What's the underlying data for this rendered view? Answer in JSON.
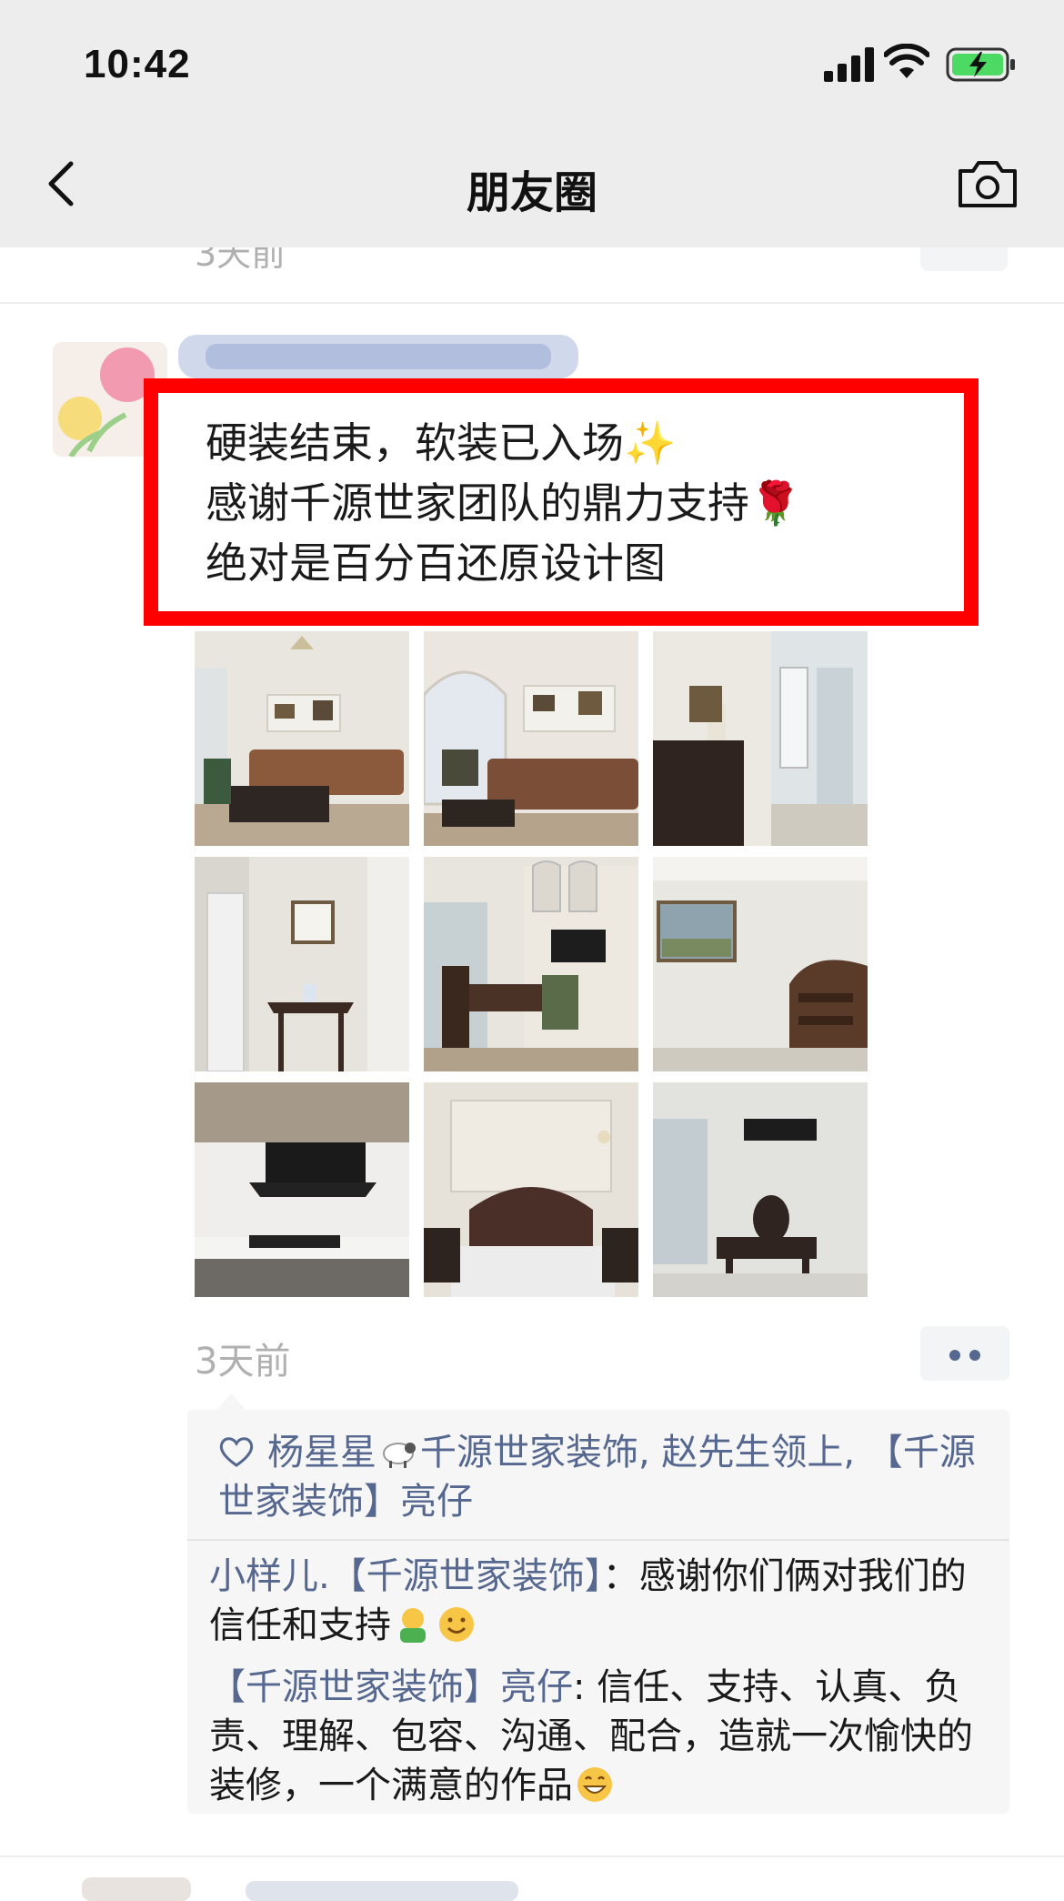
{
  "status_bar": {
    "time": "10:42"
  },
  "nav": {
    "title": "朋友圈"
  },
  "prev_post": {
    "time": "3天前"
  },
  "post": {
    "text_lines": [
      "硬装结束，软装已入场✨",
      "感谢千源世家团队的鼎力支持🌹",
      "绝对是百分百还原设计图"
    ],
    "time": "3天前",
    "photos": [
      "living-room-sofa",
      "living-room-window",
      "sideboard-balcony",
      "hallway-console",
      "dining-room",
      "bedroom-chair",
      "kitchen-range-hood",
      "bedroom-bed",
      "bedroom-vanity"
    ],
    "likes": {
      "text_before_emoji": "杨星星",
      "text_after_emoji": "千源世家装饰, 赵先生领上, 【千源世家装饰】亮仔"
    },
    "comments": [
      {
        "name": "小样儿.【千源世家装饰】",
        "text": "：感谢你们俩对我们的信任和支持"
      },
      {
        "name": "【千源世家装饰】亮仔",
        "text": ": 信任、支持、认真、负责、理解、包容、沟通、配合，造就一次愉快的装修，一个满意的作品"
      }
    ]
  },
  "colors": {
    "link_blue": "#56688f",
    "highlight_red": "#ff0000",
    "nav_bg": "#ededed"
  }
}
